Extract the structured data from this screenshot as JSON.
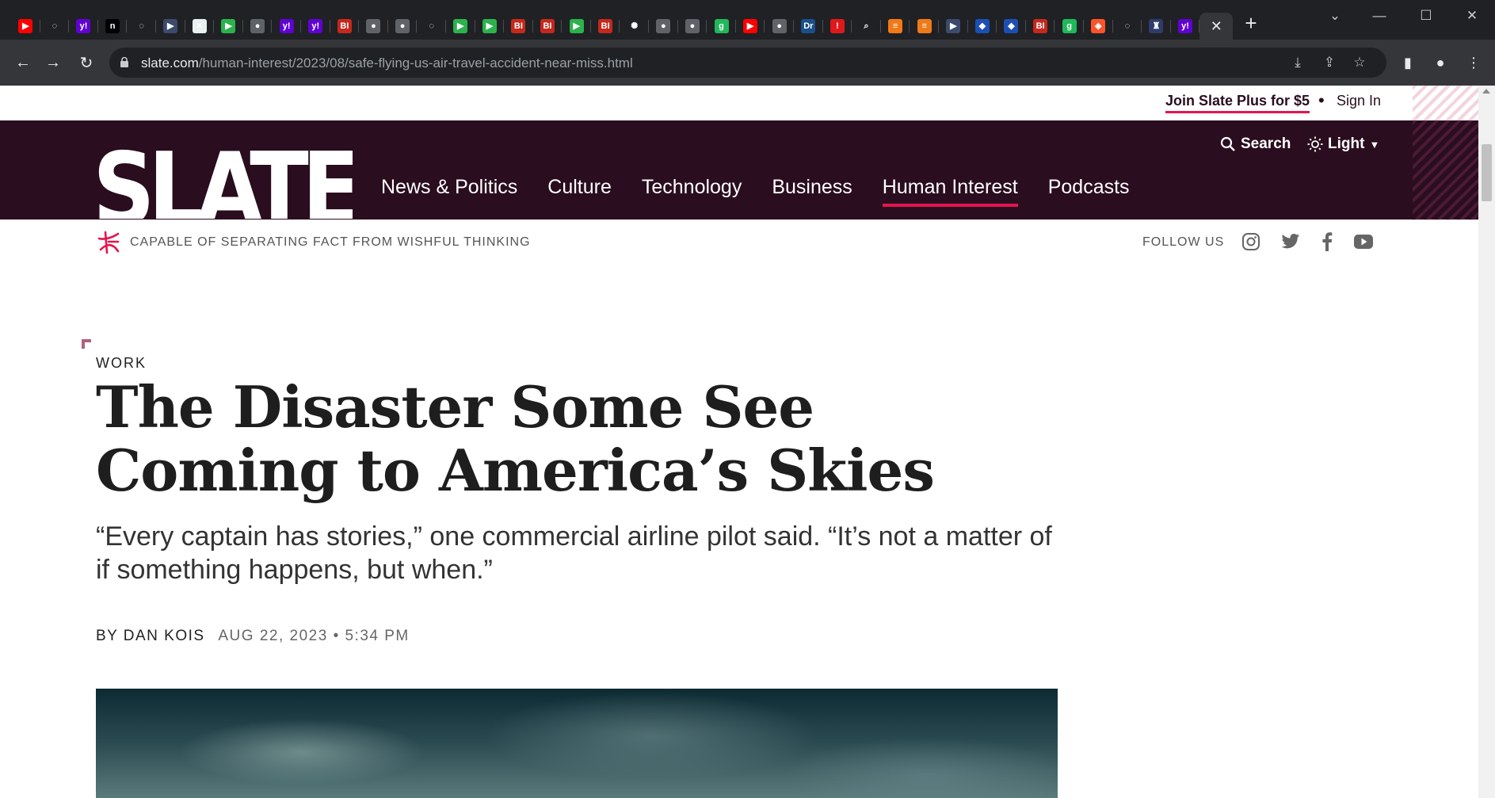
{
  "browser": {
    "tabs": [
      {
        "icon": "youtube-icon",
        "glyph": "▶",
        "bg": "#ff0000"
      },
      {
        "icon": "shield-icon",
        "glyph": "◌",
        "bg": "#202124"
      },
      {
        "icon": "yahoo-icon",
        "glyph": "y!",
        "bg": "#6001d2"
      },
      {
        "icon": "notion-icon",
        "glyph": "n",
        "bg": "#000000"
      },
      {
        "icon": "shield-icon",
        "glyph": "◌",
        "bg": "#202124"
      },
      {
        "icon": "tag-icon",
        "glyph": "▶",
        "bg": "#3c4a6b"
      },
      {
        "icon": "map-icon",
        "glyph": "✕",
        "bg": "#e8f0f0"
      },
      {
        "icon": "play-icon",
        "glyph": "▶",
        "bg": "#2bb24c"
      },
      {
        "icon": "globe-icon",
        "glyph": "●",
        "bg": "#5f6368"
      },
      {
        "icon": "yahoo-icon",
        "glyph": "y!",
        "bg": "#6001d2"
      },
      {
        "icon": "yahoo-icon",
        "glyph": "y!",
        "bg": "#6001d2"
      },
      {
        "icon": "business-insider-icon",
        "glyph": "BI",
        "bg": "#c5281c"
      },
      {
        "icon": "globe-icon",
        "glyph": "●",
        "bg": "#5f6368"
      },
      {
        "icon": "globe-icon",
        "glyph": "●",
        "bg": "#5f6368"
      },
      {
        "icon": "shield-icon",
        "glyph": "◌",
        "bg": "#202124"
      },
      {
        "icon": "play-icon",
        "glyph": "▶",
        "bg": "#2bb24c"
      },
      {
        "icon": "play-icon",
        "glyph": "▶",
        "bg": "#2bb24c"
      },
      {
        "icon": "business-insider-icon",
        "glyph": "BI",
        "bg": "#c5281c"
      },
      {
        "icon": "business-insider-icon",
        "glyph": "BI",
        "bg": "#c5281c"
      },
      {
        "icon": "play-icon",
        "glyph": "▶",
        "bg": "#2bb24c"
      },
      {
        "icon": "business-insider-icon",
        "glyph": "BI",
        "bg": "#c5281c"
      },
      {
        "icon": "burst-icon",
        "glyph": "✺",
        "bg": "#202124"
      },
      {
        "icon": "globe-icon",
        "glyph": "●",
        "bg": "#5f6368"
      },
      {
        "icon": "globe-icon",
        "glyph": "●",
        "bg": "#5f6368"
      },
      {
        "icon": "g-icon",
        "glyph": "g",
        "bg": "#1fb85a"
      },
      {
        "icon": "youtube-icon",
        "glyph": "▶",
        "bg": "#ff0000"
      },
      {
        "icon": "globe-icon",
        "glyph": "●",
        "bg": "#5f6368"
      },
      {
        "icon": "dr-icon",
        "glyph": "Dr",
        "bg": "#1a4f8a"
      },
      {
        "icon": "alert-icon",
        "glyph": "!",
        "bg": "#e0181b"
      },
      {
        "icon": "search-icon",
        "glyph": "⌕",
        "bg": "#202124"
      },
      {
        "icon": "bookmark-icon",
        "glyph": "≡",
        "bg": "#f07a18"
      },
      {
        "icon": "bookmark-icon",
        "glyph": "≡",
        "bg": "#f07a18"
      },
      {
        "icon": "tag-icon",
        "glyph": "▶",
        "bg": "#3c4a6b"
      },
      {
        "icon": "cube-icon",
        "glyph": "◆",
        "bg": "#1b4fb3"
      },
      {
        "icon": "cube-icon",
        "glyph": "◆",
        "bg": "#1b4fb3"
      },
      {
        "icon": "business-insider-icon",
        "glyph": "BI",
        "bg": "#c5281c"
      },
      {
        "icon": "g-icon",
        "glyph": "g",
        "bg": "#1fb85a"
      },
      {
        "icon": "brave-icon",
        "glyph": "◈",
        "bg": "#fb542b"
      },
      {
        "icon": "shield-icon",
        "glyph": "◌",
        "bg": "#202124"
      },
      {
        "icon": "crest-icon",
        "glyph": "♜",
        "bg": "#2f3b6b"
      },
      {
        "icon": "yahoo-icon",
        "glyph": "y!",
        "bg": "#6001d2"
      }
    ],
    "active_tab_close": "✕",
    "new_tab": "+",
    "url_host": "slate.com",
    "url_path": "/human-interest/2023/08/safe-flying-us-air-travel-accident-near-miss.html"
  },
  "header": {
    "join_label": "Join Slate Plus for $5",
    "separator": "•",
    "signin_label": "Sign In",
    "logo_text": "SLATE",
    "nav": [
      "News & Politics",
      "Culture",
      "Technology",
      "Business",
      "Human Interest",
      "Podcasts"
    ],
    "current_section": "Human Interest",
    "search_label": "Search",
    "theme_label": "Light",
    "tagline": "CAPABLE OF SEPARATING FACT FROM WISHFUL THINKING",
    "follow_label": "FOLLOW US",
    "social": [
      "instagram-icon",
      "twitter-icon",
      "facebook-icon",
      "youtube-icon"
    ]
  },
  "article": {
    "kicker": "WORK",
    "headline": "The Disaster Some See Coming to America’s Skies",
    "dek": "“Every captain has stories,” one commercial airline pilot said. “It’s not a matter of if something happens, but when.”",
    "byline": "BY DAN KOIS",
    "date": "AUG 22, 2023 • 5:34 PM"
  },
  "colors": {
    "masthead": "#2a0d1e",
    "accent": "#e5144e"
  }
}
